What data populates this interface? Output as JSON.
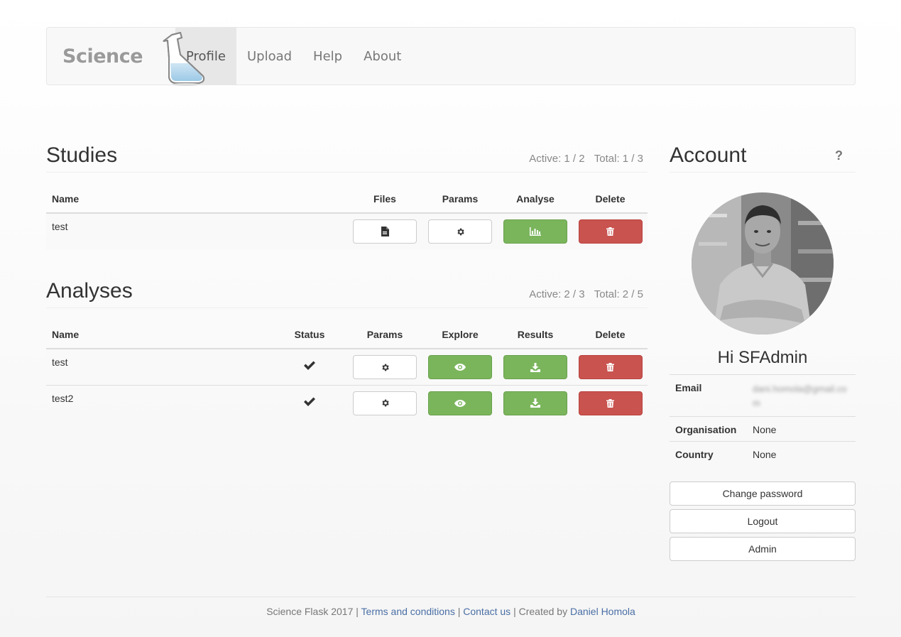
{
  "brand": {
    "name": "Science"
  },
  "nav": {
    "items": [
      {
        "label": "Profile",
        "active": true
      },
      {
        "label": "Upload",
        "active": false
      },
      {
        "label": "Help",
        "active": false
      },
      {
        "label": "About",
        "active": false
      }
    ]
  },
  "studies": {
    "title": "Studies",
    "active": "Active: 1 / 2",
    "total": "Total: 1 / 3",
    "columns": [
      "Name",
      "Files",
      "Params",
      "Analyse",
      "Delete"
    ],
    "rows": [
      {
        "name": "test",
        "actions": [
          "file-icon",
          "gear-icon",
          "bar-chart-icon",
          "trash-icon"
        ]
      }
    ]
  },
  "analyses": {
    "title": "Analyses",
    "active": "Active: 2 / 3",
    "total": "Total: 2 / 5",
    "columns": [
      "Name",
      "Status",
      "Params",
      "Explore",
      "Results",
      "Delete"
    ],
    "rows": [
      {
        "name": "test",
        "status": "check-icon",
        "actions": [
          "gear-icon",
          "eye-icon",
          "download-icon",
          "trash-icon"
        ]
      },
      {
        "name": "test2",
        "status": "check-icon",
        "actions": [
          "gear-icon",
          "eye-icon",
          "download-icon",
          "trash-icon"
        ]
      }
    ]
  },
  "account": {
    "title": "Account",
    "help": "?",
    "greeting": "Hi SFAdmin",
    "fields": [
      {
        "label": "Email",
        "value": "dani.homola@gmail.com"
      },
      {
        "label": "Organisation",
        "value": "None"
      },
      {
        "label": "Country",
        "value": "None"
      }
    ],
    "buttons": {
      "change_password": "Change password",
      "logout": "Logout",
      "admin": "Admin"
    }
  },
  "footer": {
    "prefix": "Science Flask 2017 | ",
    "terms": "Terms and conditions",
    "sep1": " | ",
    "contact": "Contact us",
    "sep2": " | Created by ",
    "author": "Daniel Homola"
  },
  "colors": {
    "success": "#7ab55c",
    "danger": "#c9534f",
    "link": "#4a6fa5"
  }
}
